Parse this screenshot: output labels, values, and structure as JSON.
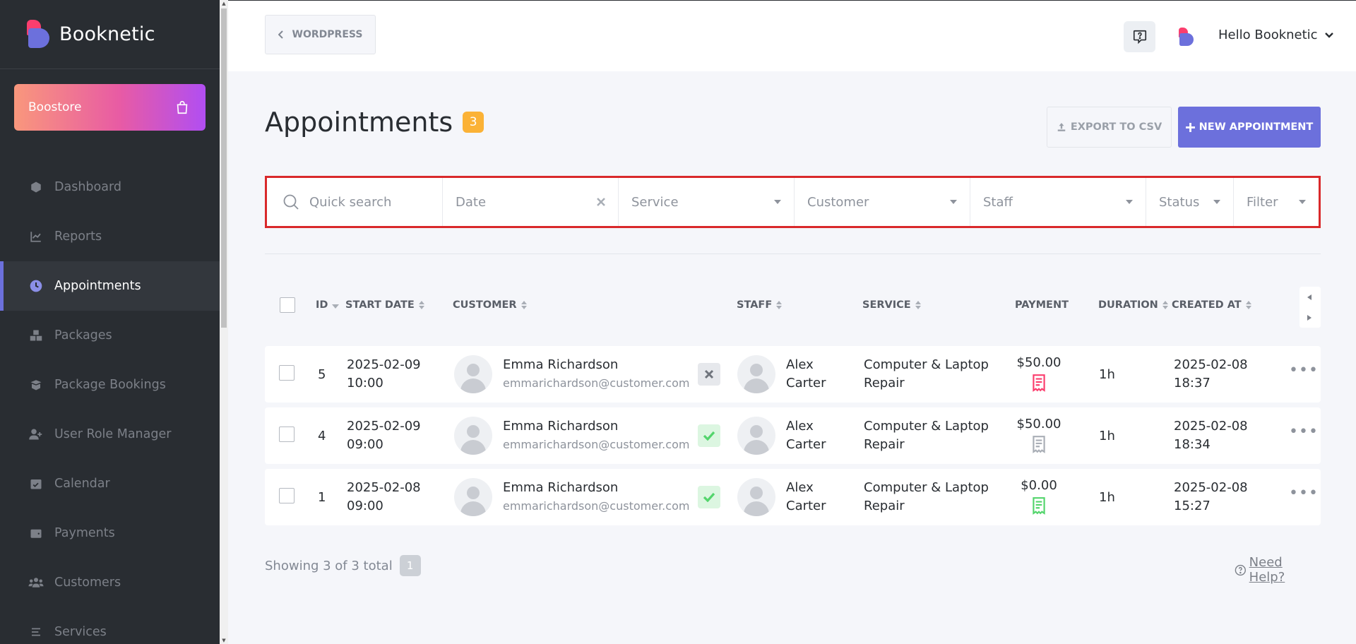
{
  "brand": {
    "name": "Booknetic",
    "primary": "#6c70dc",
    "accent": "#fb3e6e"
  },
  "sidebar": {
    "boostore_label": "Boostore",
    "items": [
      {
        "label": "Dashboard",
        "icon": "cube-icon",
        "active": false
      },
      {
        "label": "Reports",
        "icon": "chart-icon",
        "active": false
      },
      {
        "label": "Appointments",
        "icon": "clock-icon",
        "active": true
      },
      {
        "label": "Packages",
        "icon": "boxes-icon",
        "active": false
      },
      {
        "label": "Package Bookings",
        "icon": "box-open-icon",
        "active": false
      },
      {
        "label": "User Role Manager",
        "icon": "user-plus-icon",
        "active": false
      },
      {
        "label": "Calendar",
        "icon": "calendar-check-icon",
        "active": false
      },
      {
        "label": "Payments",
        "icon": "wallet-icon",
        "active": false
      },
      {
        "label": "Customers",
        "icon": "users-icon",
        "active": false
      },
      {
        "label": "Services",
        "icon": "list-icon",
        "active": false
      }
    ]
  },
  "topbar": {
    "back_label": "WORDPRESS",
    "greeting": "Hello Booknetic"
  },
  "page": {
    "title": "Appointments",
    "count": "3",
    "export_label": "EXPORT TO CSV",
    "new_label": "NEW APPOINTMENT"
  },
  "filters": {
    "search_placeholder": "Quick search",
    "date_placeholder": "Date",
    "service_placeholder": "Service",
    "customer_placeholder": "Customer",
    "staff_placeholder": "Staff",
    "status_placeholder": "Status",
    "filter_placeholder": "Filter"
  },
  "table": {
    "headers": {
      "id": "ID",
      "start_date": "START DATE",
      "customer": "CUSTOMER",
      "staff": "STAFF",
      "service": "SERVICE",
      "payment": "PAYMENT",
      "duration": "DURATION",
      "created_at": "CREATED AT"
    },
    "rows": [
      {
        "id": "5",
        "date": "2025-02-09",
        "time": "10:00",
        "customer_name": "Emma Richardson",
        "customer_email": "emmarichardson@customer.com",
        "status": "canceled",
        "staff_first": "Alex",
        "staff_last": "Carter",
        "service_line1": "Computer & Laptop",
        "service_line2": "Repair",
        "payment": "$50.00",
        "payment_status_color": "#fb3e6e",
        "duration": "1h",
        "created_date": "2025-02-08",
        "created_time": "18:37"
      },
      {
        "id": "4",
        "date": "2025-02-09",
        "time": "09:00",
        "customer_name": "Emma Richardson",
        "customer_email": "emmarichardson@customer.com",
        "status": "approved",
        "staff_first": "Alex",
        "staff_last": "Carter",
        "service_line1": "Computer & Laptop",
        "service_line2": "Repair",
        "payment": "$50.00",
        "payment_status_color": "#a9aeb6",
        "duration": "1h",
        "created_date": "2025-02-08",
        "created_time": "18:34"
      },
      {
        "id": "1",
        "date": "2025-02-08",
        "time": "09:00",
        "customer_name": "Emma Richardson",
        "customer_email": "emmarichardson@customer.com",
        "status": "approved",
        "staff_first": "Alex",
        "staff_last": "Carter",
        "service_line1": "Computer & Laptop",
        "service_line2": "Repair",
        "payment": "$0.00",
        "payment_status_color": "#53d56c",
        "duration": "1h",
        "created_date": "2025-02-08",
        "created_time": "15:27"
      }
    ]
  },
  "footer": {
    "showing": "Showing 3 of 3 total",
    "page": "1",
    "help_label": "Need Help?"
  }
}
